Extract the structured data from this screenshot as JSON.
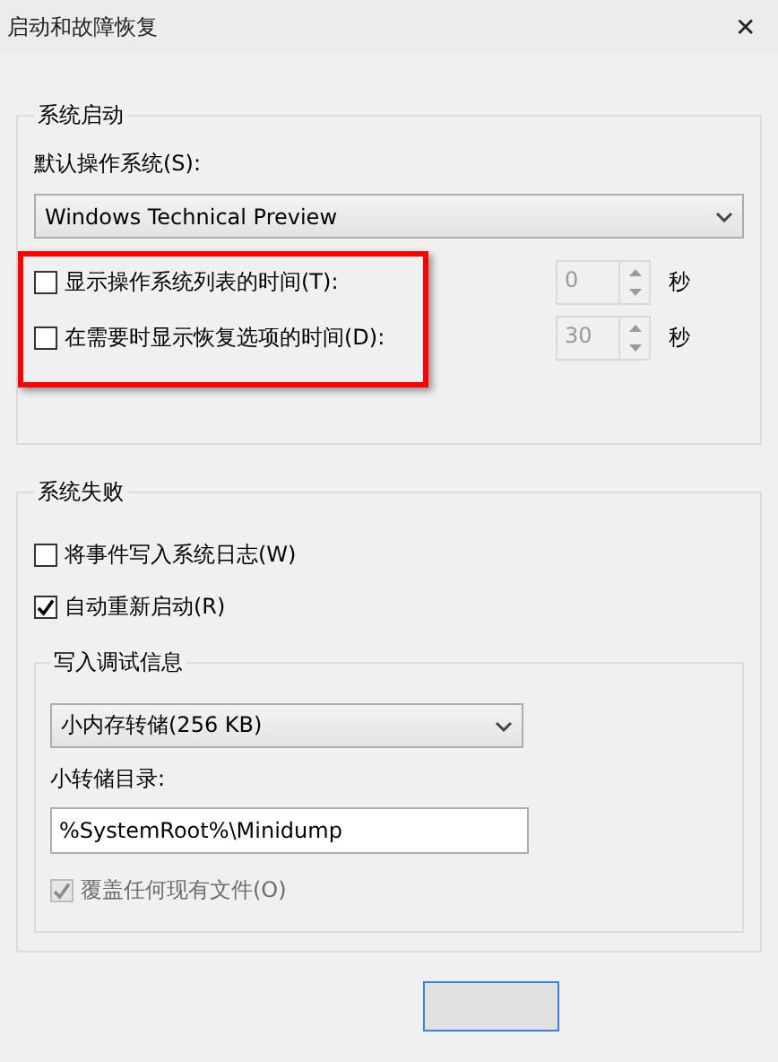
{
  "window": {
    "title": "启动和故障恢复",
    "close": "✕"
  },
  "system_startup": {
    "title": "系统启动",
    "default_os_label": "默认操作系统(S):",
    "default_os": "Windows Technical Preview",
    "options": [
      {
        "label": "显示操作系统列表的时间(T):",
        "checked": false,
        "value": "0",
        "unit": "秒",
        "disabled": true
      },
      {
        "label": "在需要时显示恢复选项的时间(D):",
        "checked": false,
        "value": "30",
        "unit": "秒",
        "disabled": true
      }
    ]
  },
  "highlight": {
    "kind": "annotation"
  },
  "system_failure": {
    "title": "系统失败",
    "options": [
      {
        "label": "将事件写入系统日志(W)",
        "checked": false
      },
      {
        "label": "自动重新启动(R)",
        "checked": true
      }
    ],
    "debug": {
      "title": "写入调试信息",
      "dump_type": "小内存转储(256 KB)",
      "dir_label": "小转储目录:",
      "dir": "%SystemRoot%\\Minidump",
      "overwrite": {
        "label": "覆盖任何现有文件(O)",
        "checked": true,
        "disabled": true
      }
    }
  },
  "buttons": [
    {
      "focused": true
    }
  ]
}
